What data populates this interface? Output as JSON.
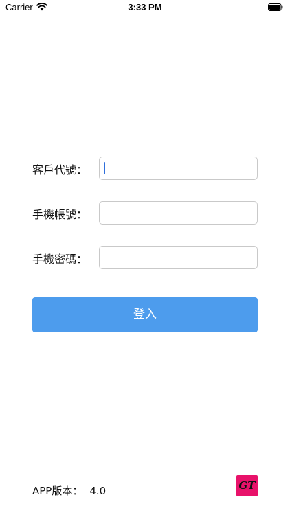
{
  "status_bar": {
    "carrier": "Carrier",
    "time": "3:33 PM",
    "icons": [
      "wifi-icon",
      "battery-icon"
    ]
  },
  "form": {
    "customer_code": {
      "label": "客戶代號：",
      "value": "",
      "placeholder": ""
    },
    "phone_account": {
      "label": "手機帳號：",
      "value": "",
      "placeholder": ""
    },
    "phone_password": {
      "label": "手機密碼：",
      "value": "",
      "placeholder": ""
    }
  },
  "login_button": {
    "label": "登入"
  },
  "footer": {
    "version_label": "APP版本：",
    "version_value": "4.0",
    "logo_text": "GT"
  },
  "colors": {
    "accent": "#4d9ced",
    "logo_bg": "#e8126a",
    "caret": "#2f6fdc",
    "input_border": "#c9c9c9"
  }
}
